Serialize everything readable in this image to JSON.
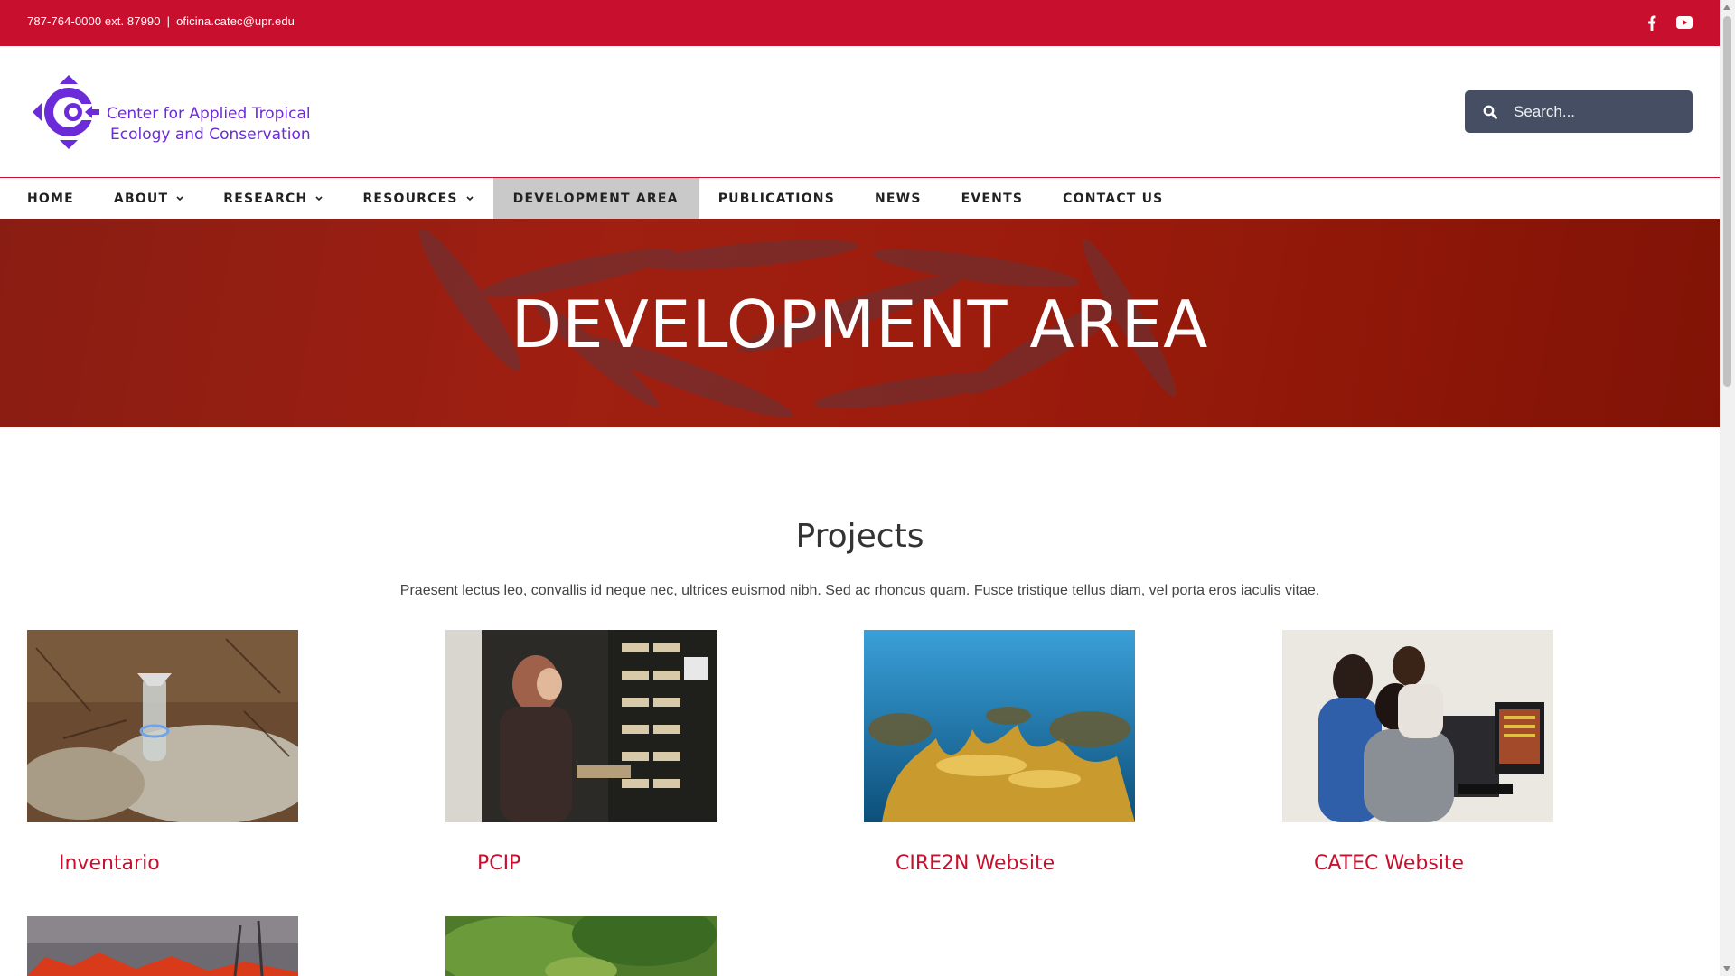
{
  "topbar": {
    "phone": "787-764-0000 ext. 87990",
    "separator": "|",
    "email": "oficina.catec@upr.edu",
    "social": [
      {
        "name": "facebook-icon"
      },
      {
        "name": "youtube-icon"
      }
    ]
  },
  "header": {
    "logo_line1": "Center for Applied Tropical",
    "logo_line2": "Ecology and Conservation",
    "search_placeholder": "Search..."
  },
  "nav": {
    "items": [
      {
        "label": "HOME",
        "dropdown": false
      },
      {
        "label": "ABOUT",
        "dropdown": true
      },
      {
        "label": "RESEARCH",
        "dropdown": true
      },
      {
        "label": "RESOURCES",
        "dropdown": true
      },
      {
        "label": "DEVELOPMENT AREA",
        "dropdown": false,
        "active": true
      },
      {
        "label": "PUBLICATIONS",
        "dropdown": false
      },
      {
        "label": "NEWS",
        "dropdown": false
      },
      {
        "label": "EVENTS",
        "dropdown": false
      },
      {
        "label": "CONTACT US",
        "dropdown": false
      }
    ]
  },
  "hero": {
    "title": "DEVELOPMENT AREA"
  },
  "projects": {
    "title": "Projects",
    "description": "Praesent lectus leo, convallis id neque nec, ultrices euismod nibh. Sed ac rhoncus quam. Fusce tristique tellus diam, vel porta eros iaculis vitae.",
    "items": [
      {
        "title": "Inventario"
      },
      {
        "title": "PCIP"
      },
      {
        "title": "CIRE2N Website"
      },
      {
        "title": "CATEC Website"
      },
      {
        "title": ""
      },
      {
        "title": ""
      }
    ]
  },
  "colors": {
    "brand_red": "#c8102e",
    "logo_purple": "#6c2bd9",
    "search_bg": "#454e63",
    "nav_active_bg": "#c9c9c9"
  }
}
